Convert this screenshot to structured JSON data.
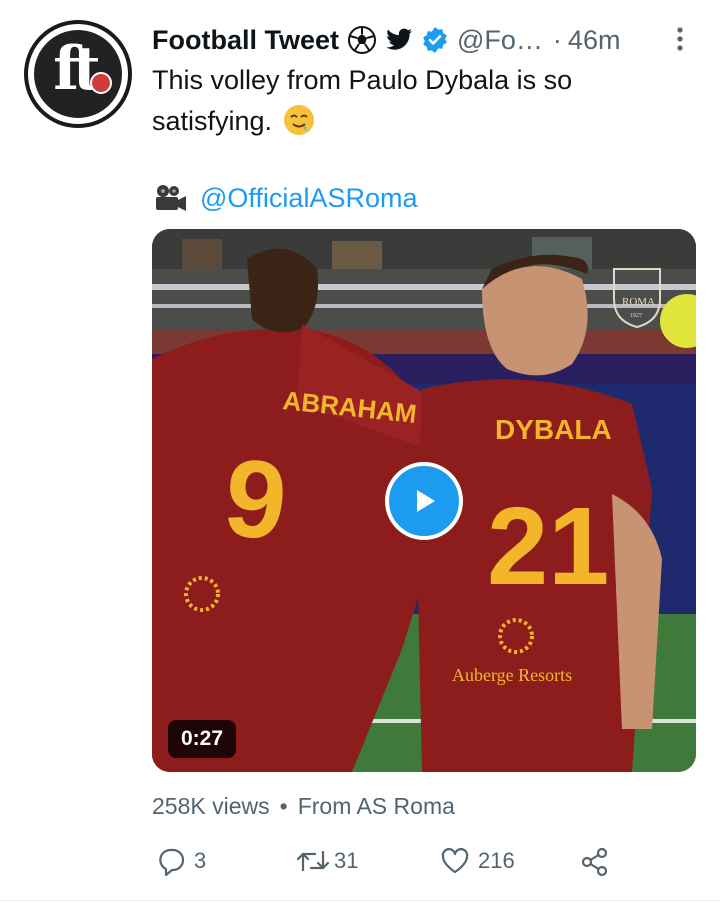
{
  "tweet": {
    "author_name": "Football Tweet",
    "handle": "@Fo…",
    "separator": "·",
    "time": "46m",
    "text": "This volley from Paulo Dybala is so satisfying.",
    "credit_handle": "@OfficialASRoma",
    "avatar_logo_text": "ft"
  },
  "video": {
    "duration": "0:27",
    "jersey_left_name": "ABRAHAM",
    "jersey_left_number": "9",
    "jersey_right_name": "DYBALA",
    "jersey_right_number": "21",
    "sponsor": "Auberge Resorts",
    "club_crest_text": "ROMA",
    "club_crest_year": "1927"
  },
  "stats": {
    "views": "258K views",
    "bullet": "•",
    "source": "From AS Roma"
  },
  "actions": {
    "replies": "3",
    "retweets": "31",
    "likes": "216"
  },
  "colors": {
    "accent": "#1d9bf0",
    "text_primary": "#0f1419",
    "text_secondary": "#536471",
    "jersey_red": "#8d1d1d",
    "jersey_gold": "#f3b62b"
  }
}
